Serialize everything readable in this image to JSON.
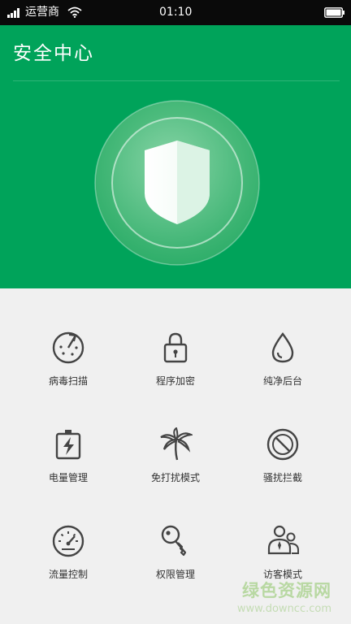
{
  "status_bar": {
    "carrier": "运营商",
    "time": "01:10",
    "signal_level": 4,
    "battery_level": 1.0
  },
  "header": {
    "title": "安全中心",
    "background_color": "#00a35a"
  },
  "features": [
    {
      "label": "病毒扫描",
      "icon": "virus-scan-icon"
    },
    {
      "label": "程序加密",
      "icon": "lock-icon"
    },
    {
      "label": "纯净后台",
      "icon": "water-drop-icon"
    },
    {
      "label": "电量管理",
      "icon": "battery-bolt-icon"
    },
    {
      "label": "免打扰模式",
      "icon": "palm-tree-icon"
    },
    {
      "label": "骚扰拦截",
      "icon": "block-icon"
    },
    {
      "label": "流量控制",
      "icon": "speedometer-icon"
    },
    {
      "label": "权限管理",
      "icon": "key-icon"
    },
    {
      "label": "访客模式",
      "icon": "guest-users-icon"
    }
  ],
  "watermark": {
    "main": "绿色资源网",
    "url": "www.downcc.com"
  }
}
